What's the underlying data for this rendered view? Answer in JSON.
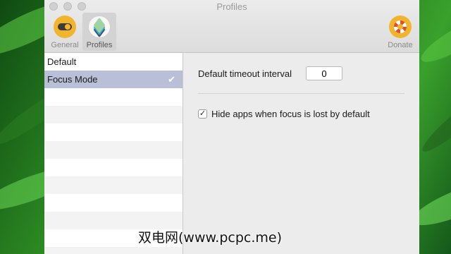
{
  "window": {
    "title": "Profiles"
  },
  "toolbar": {
    "general_label": "General",
    "profiles_label": "Profiles",
    "donate_label": "Donate",
    "general_icon": "toggle-switch-icon",
    "profiles_icon": "layers-icon",
    "donate_icon": "lifebuoy-icon"
  },
  "profiles": {
    "items": [
      {
        "label": "Default",
        "selected": false
      },
      {
        "label": "Focus Mode",
        "selected": true
      }
    ],
    "selected_icon": "checkmark-icon"
  },
  "settings": {
    "timeout_label": "Default timeout interval",
    "timeout_value": "0",
    "hide_apps_label": "Hide apps when focus is lost by default",
    "hide_apps_checked": true
  },
  "watermark": "双电网(www.pcpc.me)",
  "colors": {
    "selected_row": "#b9bfd6",
    "toolbar_icon": "#f1b52d"
  }
}
